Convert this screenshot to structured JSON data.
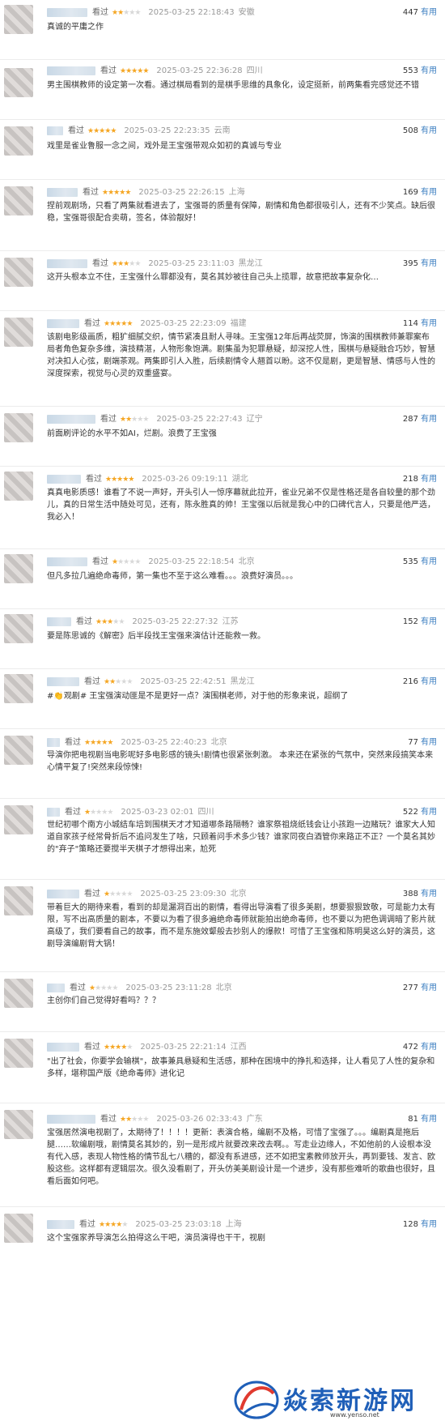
{
  "watched_label": "看过",
  "useful_label": "有用",
  "reviews": [
    {
      "stars": 2,
      "time": "2025-03-25 22:18:43",
      "location": "安徽",
      "count": "447",
      "text": "真诚的平庸之作"
    },
    {
      "stars": 5,
      "time": "2025-03-25 22:36:28",
      "location": "四川",
      "count": "553",
      "text": "男主围棋教师的设定第一次看。通过棋局看到的是棋手思维的具象化，设定挺新，前两集看完感觉还不错"
    },
    {
      "stars": 5,
      "time": "2025-03-25 22:23:35",
      "location": "云南",
      "count": "508",
      "text": "戏里是雀业鲁服一念之间，戏外是王宝强带观众如初的真诚与专业"
    },
    {
      "stars": 5,
      "time": "2025-03-25 22:26:15",
      "location": "上海",
      "count": "169",
      "text": "捏前观剧场，只看了两集就看进去了，宝强哥的质量有保障，剧情和角色都很吸引人，还有不少笑点。缺后很稳，宝强哥很配合卖萌，签名，体验靓好！"
    },
    {
      "stars": 3,
      "time": "2025-03-25 23:11:03",
      "location": "黑龙江",
      "count": "395",
      "text": "这开头根本立不住，王宝强什么罪都没有，莫名其妙被往自己头上揽罪，故意把故事复杂化…"
    },
    {
      "stars": 5,
      "time": "2025-03-25 22:23:09",
      "location": "福建",
      "count": "114",
      "text": "该剧电影级画质，粗犷细腻交织，情节紧凑且耐人寻味。王宝强12年后再战荧屏，饰演的围棋教师兼罪案布局者角色复杂多维，演技精湛，人物形象饱满。剧集虽为犯罪悬疑，却深挖人性，围棋与悬疑融合巧妙，智慧对决扣人心弦，剧端茶观。两集即引人入胜，后续剧情令人翘首以盼。这不仅是剧，更是智慧、情感与人性的深度探索，视觉与心灵的双重盛宴。"
    },
    {
      "stars": 2,
      "time": "2025-03-25 22:27:43",
      "location": "辽宁",
      "count": "287",
      "text": "前面刷评论的水平不如AI，烂剧。浪费了王宝强"
    },
    {
      "stars": 5,
      "time": "2025-03-26 09:19:11",
      "location": "湖北",
      "count": "218",
      "text": "真真电影质感！谁看了不说一声好，开头引人一惊序幕就此拉开，雀业兄弟不仅是性格还是各自较量的那个劲儿，真的日常生活中随处可见，还有，陈永胜真的帅！王宝强以后就是我心中的口碑代言人，只要是他严选，我必入！"
    },
    {
      "stars": 1,
      "time": "2025-03-25 22:18:54",
      "location": "北京",
      "count": "535",
      "text": "但凡多拉几遍绝命毒师，第一集也不至于这么难看。。。浪费好演员。。。"
    },
    {
      "stars": 3,
      "time": "2025-03-25 22:27:32",
      "location": "江苏",
      "count": "152",
      "text": "要是陈思诚的《解密》后半段找王宝强来演估计还能救一救。"
    },
    {
      "stars": 2,
      "time": "2025-03-25 22:42:51",
      "location": "黑龙江",
      "count": "216",
      "text": "#👏观剧# 王宝强演动匪是不是更好一点？演围棋老师，对于他的形象来说，超纲了"
    },
    {
      "stars": 5,
      "time": "2025-03-25 22:40:23",
      "location": "北京",
      "count": "77",
      "text": "导演你把电视剧当电影呢好多电影感的镜头!剧情也很紧张刺激。 本来还在紧张的气氛中，突然来段搞笑本来心情平复了!突然来段惊悚!"
    },
    {
      "stars": 1,
      "time": "2025-03-23 02:01",
      "location": "四川",
      "count": "522",
      "text": "世纪初哪个南方小城结车培到围棋天才才知道哪条路隔畅？谁家祭祖烧纸钱会让小孩跑一边赌玩？谁家大人知道自家孩子经常骨折后不追问发生了啥，只顾着问手术多少钱？谁家同夜白酒管你来路正不正？一个莫名其妙的\"弃子\"策略还要搅半天棋子才想得出来，尬死"
    },
    {
      "stars": 1,
      "time": "2025-03-25 23:09:30",
      "location": "北京",
      "count": "388",
      "text": "带着巨大的期待来看，看到的却是漏洞百出的剧情，看得出导演看了很多美剧，想要狠狠致敬，可是能力太有限，写不出高质量的剧本，不要以为看了很多遍绝命毒师就能拍出绝命毒师，也不要以为把色调调暗了影片就高级了，我们要看自己的故事，而不是东施效颦般去抄别人的爆款！可惜了王宝强和陈明昊这么好的演员，这剧导演编剧背大锅！"
    },
    {
      "stars": 1,
      "time": "2025-03-25 23:11:28",
      "location": "北京",
      "count": "277",
      "text": "主创你们自己觉得好看吗？？？"
    },
    {
      "stars": 4,
      "time": "2025-03-25 22:21:14",
      "location": "江西",
      "count": "472",
      "text": "\"出了社会，你要学会输棋\"，故事兼具悬疑和生活感，那种在困境中的挣扎和选择，让人看见了人性的复杂和多样，堪称国产版《绝命毒师》进化记"
    },
    {
      "stars": 2,
      "time": "2025-03-26 02:33:43",
      "location": "广东",
      "count": "81",
      "text": "宝强居然演电视剧了，太期待了！！！！更新：表演合格，编剧不及格，可惜了宝强了。。。编剧真是拖后腿……软编剧哦，剧情莫名其妙的，别一是形成片就要改来改去啊。。写走业边缘人，不如他前的人设根本没有代入感，表现人物性格的情节乱七八糟的，都没有系进感，还不如把宝素教师放开头，再到要钱、发言、欧股这些。这样都有逻辑层次。很久没看剧了，开头仿美美剧设计是一个进步，没有那些难听的歌曲也很好，且看后面如何吧。"
    },
    {
      "stars": 4,
      "time": "2025-03-25 23:03:18",
      "location": "上海",
      "count": "128",
      "text": "这个宝强家养导演怎么拍得这么干吧，演员演得也干干，视剧"
    }
  ],
  "watermark": {
    "text": "焱索新游网",
    "url": "www.yenso.net"
  }
}
